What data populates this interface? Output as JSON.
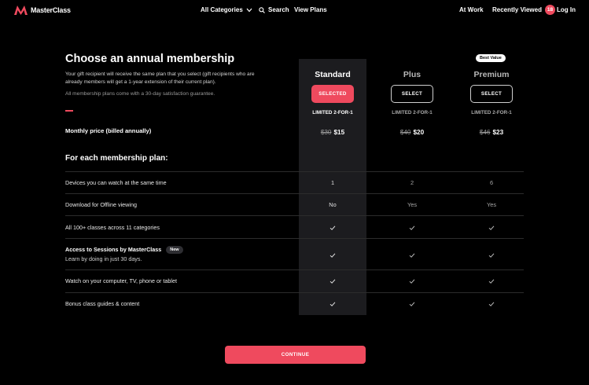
{
  "header": {
    "brand": "MasterClass",
    "categories": "All Categories",
    "search": "Search",
    "view_plans": "View Plans",
    "at_work": "At Work",
    "recently_viewed": "Recently Viewed",
    "recent_count": "18",
    "login": "Log In"
  },
  "intro": {
    "title": "Choose an annual membership",
    "description": "Your gift recipient will receive the same plan that you select (gift recipients who are already members will get a 1-year extension of their current plan).",
    "guarantee": "All membership plans come with a 30-day satisfaction guarantee.",
    "price_label": "Monthly price (billed annually)",
    "each_label": "For each membership plan:"
  },
  "plans": [
    {
      "name": "Standard",
      "button": "SELECTED",
      "promo": "LIMITED 2-FOR-1",
      "old_price": "$30",
      "new_price": "$15"
    },
    {
      "name": "Plus",
      "button": "SELECT",
      "promo": "LIMITED 2-FOR-1",
      "old_price": "$40",
      "new_price": "$20"
    },
    {
      "name": "Premium",
      "button": "SELECT",
      "promo": "LIMITED 2-FOR-1",
      "old_price": "$46",
      "new_price": "$23",
      "badge": "Best Value"
    }
  ],
  "features": [
    {
      "label": "Devices you can watch at the same time",
      "values": [
        "1",
        "2",
        "6"
      ]
    },
    {
      "label": "Download for Offline viewing",
      "values": [
        "No",
        "Yes",
        "Yes"
      ]
    },
    {
      "label": "All 100+ classes across 11 categories",
      "check": true
    },
    {
      "label": "Access to Sessions by MasterClass",
      "badge": "New",
      "sub": "Learn by doing in just 30 days.",
      "check": true
    },
    {
      "label": "Watch on your computer, TV, phone or tablet",
      "check": true
    },
    {
      "label": "Bonus class guides & content",
      "check": true
    }
  ],
  "continue_label": "CONTINUE",
  "colors": {
    "accent": "#ef4a5e",
    "background": "#000000",
    "highlight_column": "#1c1c1f"
  },
  "icons": [
    "masterclass-logo-icon",
    "chevron-down-icon",
    "search-icon",
    "check-icon"
  ]
}
